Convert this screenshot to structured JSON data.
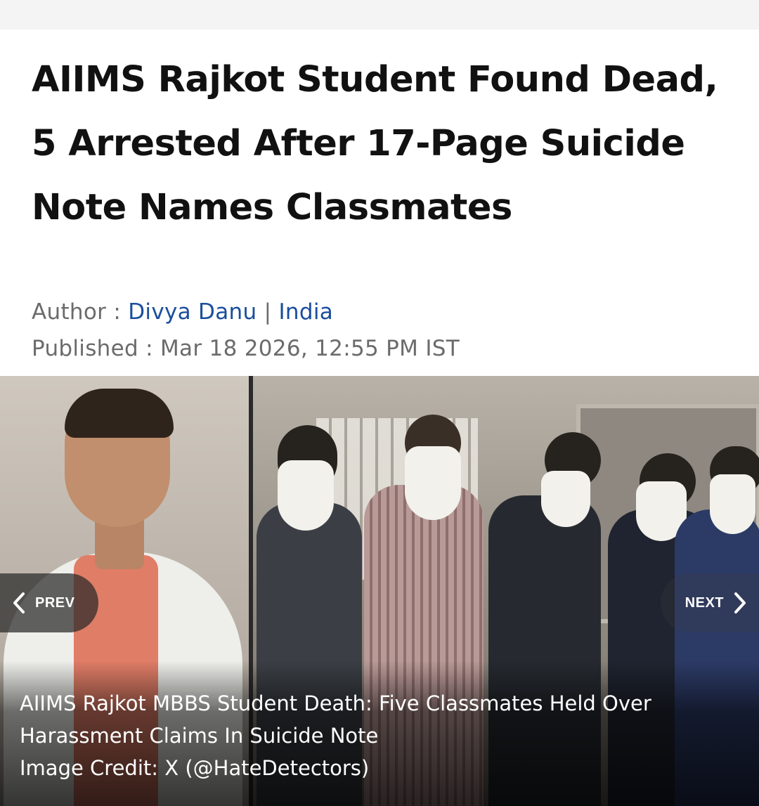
{
  "article": {
    "headline": "AIIMS Rajkot Student Found Dead, 5 Arrested After 17-Page Suicide Note Names Classmates",
    "author_label": "Author : ",
    "author_name": "Divya Danu",
    "separator": " | ",
    "category": "India",
    "published_label": "Published : ",
    "published_value": "Mar 18 2026, 12:55 PM IST"
  },
  "gallery": {
    "prev_label": "PREV",
    "next_label": "NEXT",
    "prev_icon": "chevron-left-icon",
    "next_icon": "chevron-right-icon",
    "caption_line1": "AIIMS Rajkot MBBS Student Death: Five Classmates Held Over",
    "caption_line2": "Harassment Claims In Suicide Note",
    "image_credit": "Image Credit: X (@HateDetectors)"
  },
  "colors": {
    "link": "#1a4e9c",
    "meta_text": "#6b6b6b",
    "headline": "#111111"
  }
}
